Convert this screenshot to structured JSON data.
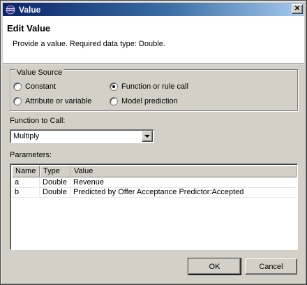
{
  "window": {
    "title": "Value",
    "title_icon": "eclipse-icon",
    "close_glyph": "✕"
  },
  "header": {
    "title": "Edit Value",
    "message": "Provide a value. Required data type: Double."
  },
  "value_source": {
    "legend": "Value Source",
    "options": [
      {
        "label": "Constant",
        "checked": false
      },
      {
        "label": "Function or rule call",
        "checked": true
      },
      {
        "label": "Attribute or variable",
        "checked": false
      },
      {
        "label": "Model prediction",
        "checked": false
      }
    ]
  },
  "function": {
    "label": "Function to Call:",
    "selected": "Multiply"
  },
  "parameters": {
    "label": "Parameters:",
    "columns": [
      "Name",
      "Type",
      "Value"
    ],
    "rows": [
      [
        "a",
        "Double",
        "Revenue"
      ],
      [
        "b",
        "Double",
        "Predicted by Offer Acceptance Predictor:Accepted"
      ]
    ]
  },
  "buttons": {
    "ok": "OK",
    "cancel": "Cancel"
  }
}
